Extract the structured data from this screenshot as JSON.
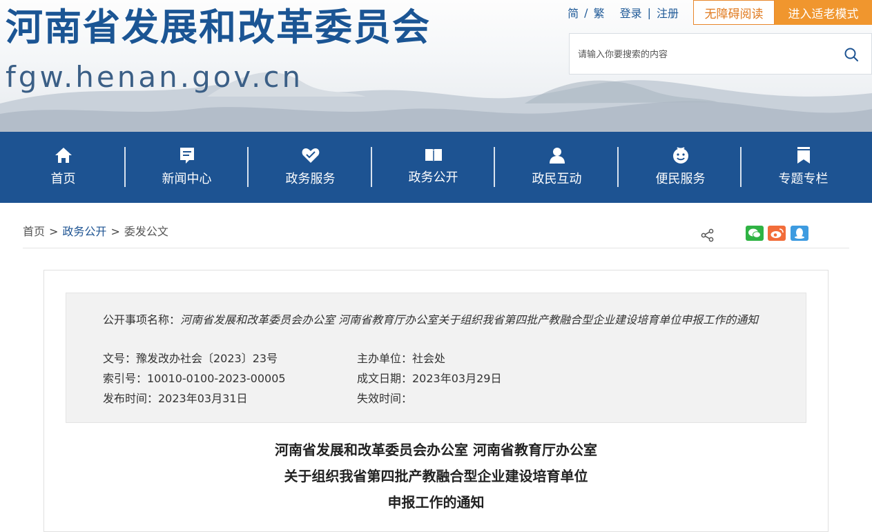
{
  "header": {
    "title": "河南省发展和改革委员会",
    "url": "fgw.henan.gov.cn",
    "links": {
      "simplified": "简",
      "traditional": "繁",
      "login": "登录",
      "register": "注册",
      "slash": "/",
      "bar": "|"
    },
    "accessibility_button": "无障碍阅读",
    "elder_mode_button": "进入适老模式",
    "search": {
      "placeholder": "请输入你要搜索的内容"
    }
  },
  "nav": {
    "items": [
      {
        "label": "首页",
        "icon": "home-icon"
      },
      {
        "label": "新闻中心",
        "icon": "document-icon"
      },
      {
        "label": "政务服务",
        "icon": "handshake-icon"
      },
      {
        "label": "政务公开",
        "icon": "book-icon"
      },
      {
        "label": "政民互动",
        "icon": "user-icon"
      },
      {
        "label": "便民服务",
        "icon": "smile-face-icon"
      },
      {
        "label": "专题专栏",
        "icon": "bookmark-icon"
      }
    ]
  },
  "breadcrumb": {
    "items": [
      "首页",
      "政务公开",
      "委发公文"
    ],
    "separator": ">"
  },
  "share": {
    "icons": [
      "share-icon",
      "wechat-icon",
      "weibo-icon",
      "qq-icon"
    ]
  },
  "meta": {
    "name_label": "公开事项名称：",
    "name_value": "河南省发展和改革委员会办公室 河南省教育厅办公室关于组织我省第四批产教融合型企业建设培育单位申报工作的通知",
    "doc_no": "文号：豫发改办社会〔2023〕23号",
    "sponsor": "主办单位：社会处",
    "index_no": "索引号：10010-0100-2023-00005",
    "created_date": "成文日期：2023年03月29日",
    "publish_time": "发布时间：2023年03月31日",
    "expire_time": "失效时间："
  },
  "document": {
    "title_lines": [
      "河南省发展和改革委员会办公室 河南省教育厅办公室",
      "关于组织我省第四批产教融合型企业建设培育单位",
      "申报工作的通知"
    ]
  }
}
